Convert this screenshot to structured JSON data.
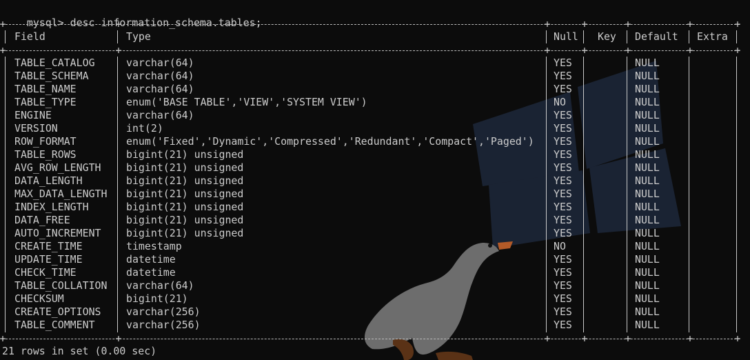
{
  "terminal": {
    "prompt": "mysql>",
    "command": "desc information_schema.tables;",
    "footer": "21 rows in set (0.00 sec)"
  },
  "table": {
    "headers": {
      "field": "Field",
      "type": "Type",
      "null": "Null",
      "key": "Key",
      "default": "Default",
      "extra": "Extra"
    },
    "rows": [
      {
        "field": "TABLE_CATALOG",
        "type": "varchar(64)",
        "null": "YES",
        "key": "",
        "default": "NULL",
        "extra": ""
      },
      {
        "field": "TABLE_SCHEMA",
        "type": "varchar(64)",
        "null": "YES",
        "key": "",
        "default": "NULL",
        "extra": ""
      },
      {
        "field": "TABLE_NAME",
        "type": "varchar(64)",
        "null": "YES",
        "key": "",
        "default": "NULL",
        "extra": ""
      },
      {
        "field": "TABLE_TYPE",
        "type": "enum('BASE TABLE','VIEW','SYSTEM VIEW')",
        "null": "NO",
        "key": "",
        "default": "NULL",
        "extra": ""
      },
      {
        "field": "ENGINE",
        "type": "varchar(64)",
        "null": "YES",
        "key": "",
        "default": "NULL",
        "extra": ""
      },
      {
        "field": "VERSION",
        "type": "int(2)",
        "null": "YES",
        "key": "",
        "default": "NULL",
        "extra": ""
      },
      {
        "field": "ROW_FORMAT",
        "type": "enum('Fixed','Dynamic','Compressed','Redundant','Compact','Paged')",
        "null": "YES",
        "key": "",
        "default": "NULL",
        "extra": ""
      },
      {
        "field": "TABLE_ROWS",
        "type": "bigint(21) unsigned",
        "null": "YES",
        "key": "",
        "default": "NULL",
        "extra": ""
      },
      {
        "field": "AVG_ROW_LENGTH",
        "type": "bigint(21) unsigned",
        "null": "YES",
        "key": "",
        "default": "NULL",
        "extra": ""
      },
      {
        "field": "DATA_LENGTH",
        "type": "bigint(21) unsigned",
        "null": "YES",
        "key": "",
        "default": "NULL",
        "extra": ""
      },
      {
        "field": "MAX_DATA_LENGTH",
        "type": "bigint(21) unsigned",
        "null": "YES",
        "key": "",
        "default": "NULL",
        "extra": ""
      },
      {
        "field": "INDEX_LENGTH",
        "type": "bigint(21) unsigned",
        "null": "YES",
        "key": "",
        "default": "NULL",
        "extra": ""
      },
      {
        "field": "DATA_FREE",
        "type": "bigint(21) unsigned",
        "null": "YES",
        "key": "",
        "default": "NULL",
        "extra": ""
      },
      {
        "field": "AUTO_INCREMENT",
        "type": "bigint(21) unsigned",
        "null": "YES",
        "key": "",
        "default": "NULL",
        "extra": ""
      },
      {
        "field": "CREATE_TIME",
        "type": "timestamp",
        "null": "NO",
        "key": "",
        "default": "NULL",
        "extra": ""
      },
      {
        "field": "UPDATE_TIME",
        "type": "datetime",
        "null": "YES",
        "key": "",
        "default": "NULL",
        "extra": ""
      },
      {
        "field": "CHECK_TIME",
        "type": "datetime",
        "null": "YES",
        "key": "",
        "default": "NULL",
        "extra": ""
      },
      {
        "field": "TABLE_COLLATION",
        "type": "varchar(64)",
        "null": "YES",
        "key": "",
        "default": "NULL",
        "extra": ""
      },
      {
        "field": "CHECKSUM",
        "type": "bigint(21)",
        "null": "YES",
        "key": "",
        "default": "NULL",
        "extra": ""
      },
      {
        "field": "CREATE_OPTIONS",
        "type": "varchar(256)",
        "null": "YES",
        "key": "",
        "default": "NULL",
        "extra": ""
      },
      {
        "field": "TABLE_COMMENT",
        "type": "varchar(256)",
        "null": "YES",
        "key": "",
        "default": "NULL",
        "extra": ""
      }
    ]
  },
  "background": {
    "logo_icon": "windows-logo-icon",
    "logo_color": "#1a2333",
    "mascot_icon": "goose-icon",
    "goose_body_color": "#7b7b7b",
    "goose_beak_color": "#b35a28",
    "text_color": "#cccccc",
    "terminal_bg": "#0c0c0c"
  }
}
